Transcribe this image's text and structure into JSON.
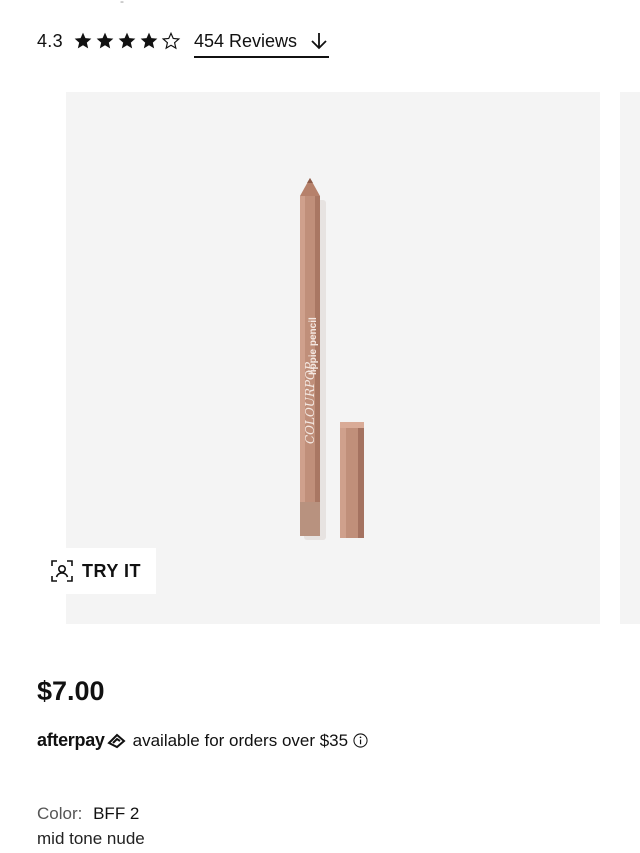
{
  "rating": {
    "value": "4.3",
    "stars_filled": 4,
    "stars_total": 5,
    "reviews_label": "454 Reviews"
  },
  "gallery": {
    "product_brand_text": "COLOURPOP",
    "product_name_text": "lippie pencil",
    "pencil_color": "#c08f7a",
    "try_it_label": "TRY IT"
  },
  "price": "$7.00",
  "afterpay": {
    "logo_text": "afterpay",
    "message": "available for orders over $35"
  },
  "color": {
    "label": "Color:",
    "value": "BFF 2",
    "description": "mid tone nude"
  }
}
